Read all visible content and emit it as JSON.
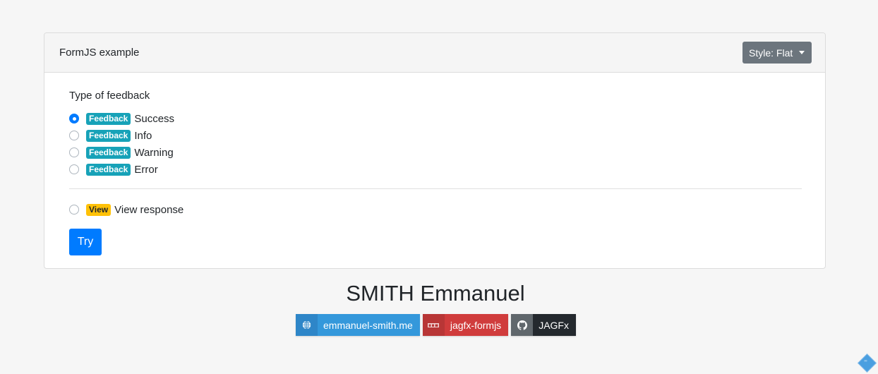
{
  "card": {
    "title": "FormJS example",
    "style_dropdown": {
      "label": "Style: Flat"
    }
  },
  "form": {
    "group_label": "Type of feedback",
    "options": [
      {
        "badge": "Feedback",
        "label": "Success",
        "checked": true
      },
      {
        "badge": "Feedback",
        "label": "Info",
        "checked": false
      },
      {
        "badge": "Feedback",
        "label": "Warning",
        "checked": false
      },
      {
        "badge": "Feedback",
        "label": "Error",
        "checked": false
      }
    ],
    "view_option": {
      "badge": "View",
      "label": "View response",
      "checked": false
    },
    "submit_label": "Try"
  },
  "footer": {
    "author": "SMITH Emmanuel",
    "links": [
      {
        "icon": "globe-icon",
        "label": "emmanuel-smith.me"
      },
      {
        "icon": "npm-icon",
        "label": "jagfx-formjs"
      },
      {
        "icon": "github-icon",
        "label": "JAGFx"
      }
    ]
  },
  "colors": {
    "primary": "#007bff",
    "info": "#17a2b8",
    "warning": "#ffc107",
    "secondary": "#6c757d"
  }
}
